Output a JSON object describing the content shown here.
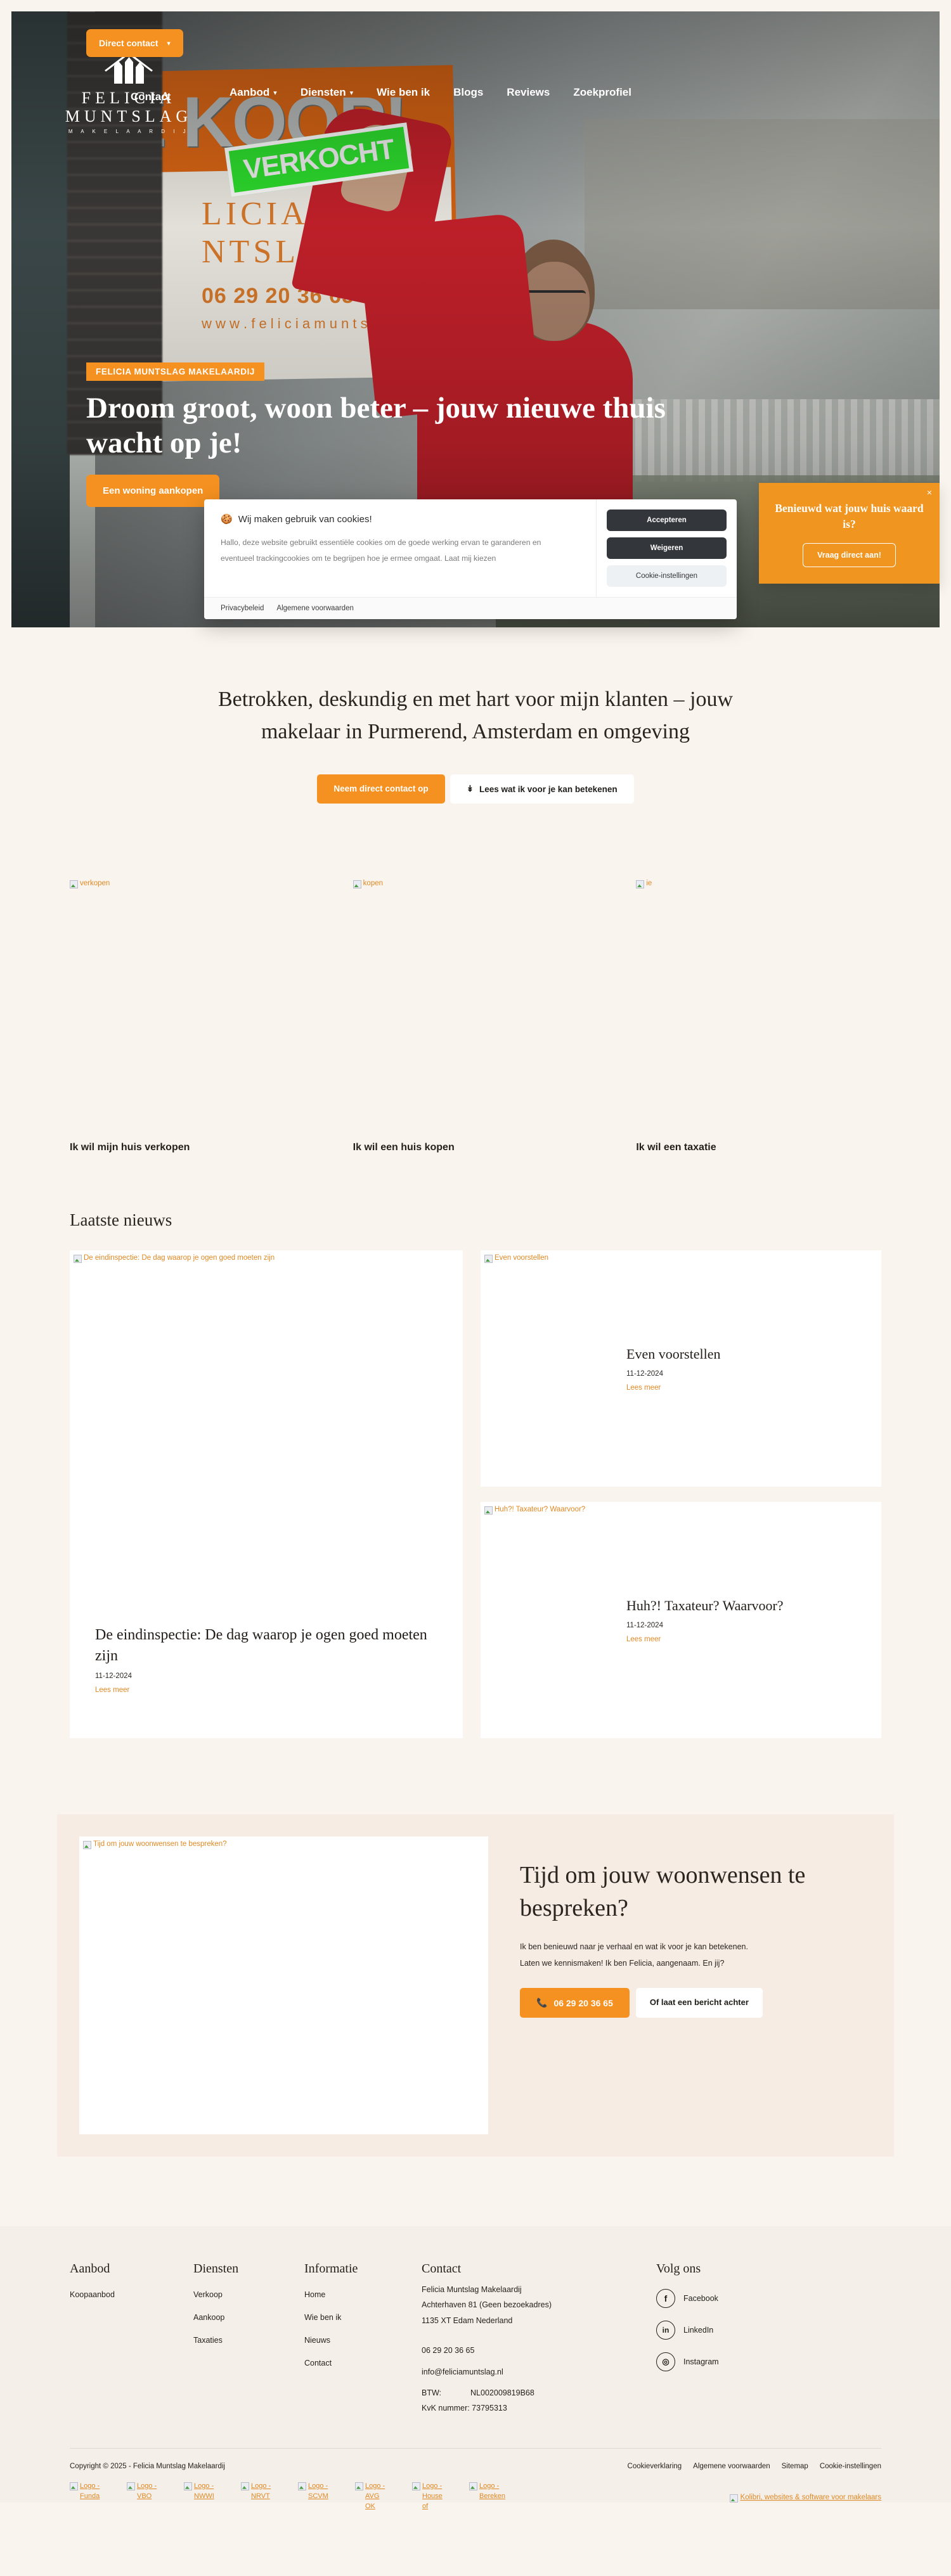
{
  "brand": {
    "name_line1": "FELICIA",
    "name_line2": "MUNTSLAG",
    "name_line3": "M A K E L A A R D I J",
    "accent": "#f59120",
    "page_bg": "#faf4ee"
  },
  "nav": {
    "direct_contact": "Direct contact",
    "direct_contact_chevron": "chevron-down-icon",
    "contact": "Contact",
    "items": [
      {
        "label": "Aanbod",
        "has_chevron": true
      },
      {
        "label": "Diensten",
        "has_chevron": true
      },
      {
        "label": "Wie ben ik",
        "has_chevron": false
      },
      {
        "label": "Blogs",
        "has_chevron": false
      },
      {
        "label": "Reviews",
        "has_chevron": false
      },
      {
        "label": "Zoekprofiel",
        "has_chevron": false
      }
    ]
  },
  "hero": {
    "badge": "FELICIA MUNTSLAG MAKELAARDIJ",
    "heading": "Droom groot, woon beter – jouw nieuwe thuis wacht op je!",
    "cta": "Een woning aankopen",
    "sign_koop": "E KOOP!",
    "sign_verkocht": "VERKOCHT",
    "sign_logo_l1": "LICIA",
    "sign_logo_l2": "NTSLAG",
    "sign_phone": "06 29 20 36 65",
    "sign_url": "w w w . f e l i c i a m u n t s l a g . n l"
  },
  "cookie": {
    "icon": "cookie-icon",
    "title": "Wij maken gebruik van cookies!",
    "text": "Hallo, deze website gebruikt essentiële cookies om de goede werking ervan te garanderen en eventueel trackingcookies om te begrijpen hoe je ermee omgaat. Laat mij kiezen",
    "accept": "Accepteren",
    "refuse": "Weigeren",
    "settings": "Cookie-instellingen",
    "privacy": "Privacybeleid",
    "terms": "Algemene voorwaarden"
  },
  "valuebox": {
    "close": "×",
    "title": "Benieuwd wat jouw huis waard is?",
    "button": "Vraag direct aan!"
  },
  "intro": {
    "heading": "Betrokken, deskundig en met hart voor mijn klanten – jouw makelaar in Purmerend, Amsterdam en omgeving",
    "btn_primary": "Neem direct contact op",
    "btn_secondary": "Lees wat ik voor je kan betekenen",
    "btn_secondary_icon": "chevrons-down-icon"
  },
  "services": [
    {
      "alt": "verkopen",
      "title": "Ik wil mijn huis verkopen"
    },
    {
      "alt": "kopen",
      "title": "Ik wil een huis kopen"
    },
    {
      "alt": "ie",
      "title": "Ik wil een taxatie"
    }
  ],
  "news": {
    "heading": "Laatste nieuws",
    "read_more": "Lees meer",
    "featured": {
      "alt": "De eindinspectie: De dag waarop je ogen goed moeten zijn",
      "title": "De eindinspectie: De dag waarop je ogen goed moeten zijn",
      "date": "11-12-2024",
      "link": "Lees meer"
    },
    "items": [
      {
        "alt": "Even voorstellen",
        "title": "Even voorstellen",
        "date": "11-12-2024",
        "link": "Lees meer"
      },
      {
        "alt": "Huh?! Taxateur? Waarvoor?",
        "title": "Huh?! Taxateur? Waarvoor?",
        "date": "11-12-2024",
        "link": "Lees meer"
      }
    ]
  },
  "cta": {
    "image_alt": "Tijd om jouw woonwensen te bespreken?",
    "heading": "Tijd om jouw woonwensen te bespreken?",
    "p1": "Ik ben benieuwd naar je verhaal en wat ik voor je kan betekenen.",
    "p2": "Laten we kennismaken! Ik ben Felicia, aangenaam. En jij?",
    "phone_icon": "phone-icon",
    "phone": "06 29 20 36 65",
    "btn_message": "Of laat een bericht achter"
  },
  "footer": {
    "columns": [
      {
        "heading": "Aanbod",
        "links": [
          "Koopaanbod"
        ]
      },
      {
        "heading": "Diensten",
        "links": [
          "Verkoop",
          "Aankoop",
          "Taxaties"
        ]
      },
      {
        "heading": "Informatie",
        "links": [
          "Home",
          "Wie ben ik",
          "Nieuws",
          "Contact"
        ]
      }
    ],
    "contact": {
      "heading": "Contact",
      "company": "Felicia Muntslag Makelaardij",
      "address1": "Achterhaven 81 (Geen bezoekadres)",
      "address2": "1135 XT Edam Nederland",
      "phone": "06 29 20 36 65",
      "email": "info@feliciamuntslag.nl",
      "btw_label": "BTW:",
      "btw_value": "NL002009819B68",
      "kvk": "KvK nummer: 73795313"
    },
    "social": {
      "heading": "Volg ons",
      "items": [
        {
          "icon": "facebook-icon",
          "glyph": "f",
          "label": "Facebook"
        },
        {
          "icon": "linkedin-icon",
          "glyph": "in",
          "label": "LinkedIn"
        },
        {
          "icon": "instagram-icon",
          "glyph": "◎",
          "label": "Instagram"
        }
      ]
    },
    "copyright": "Copyright © 2025 - Felicia Muntslag Makelaardij",
    "bottom_links": [
      "Cookieverklaring",
      "Algemene voorwaarden",
      "Sitemap",
      "Cookie-instellingen"
    ],
    "partner_logos": [
      "Logo - Funda",
      "Logo - VBO",
      "Logo - NWWI",
      "Logo - NRVT",
      "Logo - SCVM",
      "Logo - AVG OK",
      "Logo - House of",
      "Logo - Bereken"
    ],
    "credit": "Kolibri, websites & software voor makelaars"
  }
}
